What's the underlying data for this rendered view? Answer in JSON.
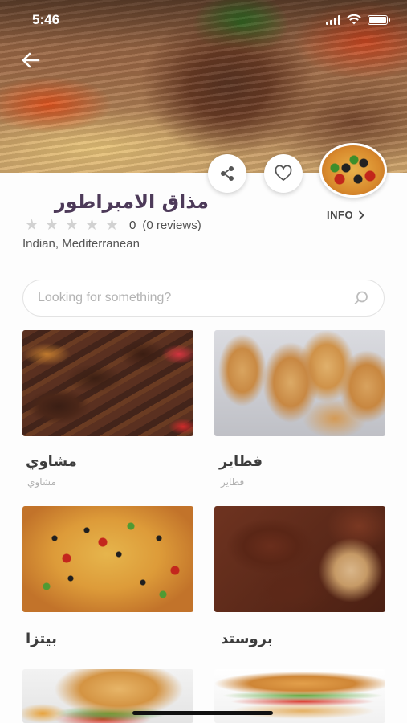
{
  "status_bar": {
    "time": "5:46"
  },
  "restaurant": {
    "name": "مذاق الامبراطور",
    "rating_value": "0",
    "rating_count": "(0 reviews)",
    "stars_total": 5,
    "stars_filled": 0,
    "cuisine": "Indian, Mediterranean",
    "info_label": "INFO"
  },
  "search": {
    "placeholder": "Looking for something?"
  },
  "categories": [
    {
      "title": "مشاوي",
      "subtitle": "مشاوي"
    },
    {
      "title": "فطاير",
      "subtitle": "فطاير"
    },
    {
      "title": "بيتزا",
      "subtitle": ""
    },
    {
      "title": "بروستد",
      "subtitle": ""
    },
    {
      "title": "",
      "subtitle": ""
    },
    {
      "title": "",
      "subtitle": ""
    }
  ],
  "colors": {
    "title": "#4d3a59",
    "star_empty": "#d2d2d2",
    "placeholder": "#b3b3b3"
  },
  "icons": [
    "back-arrow-icon",
    "share-icon",
    "heart-icon",
    "chevron-right-icon",
    "search-icon"
  ]
}
